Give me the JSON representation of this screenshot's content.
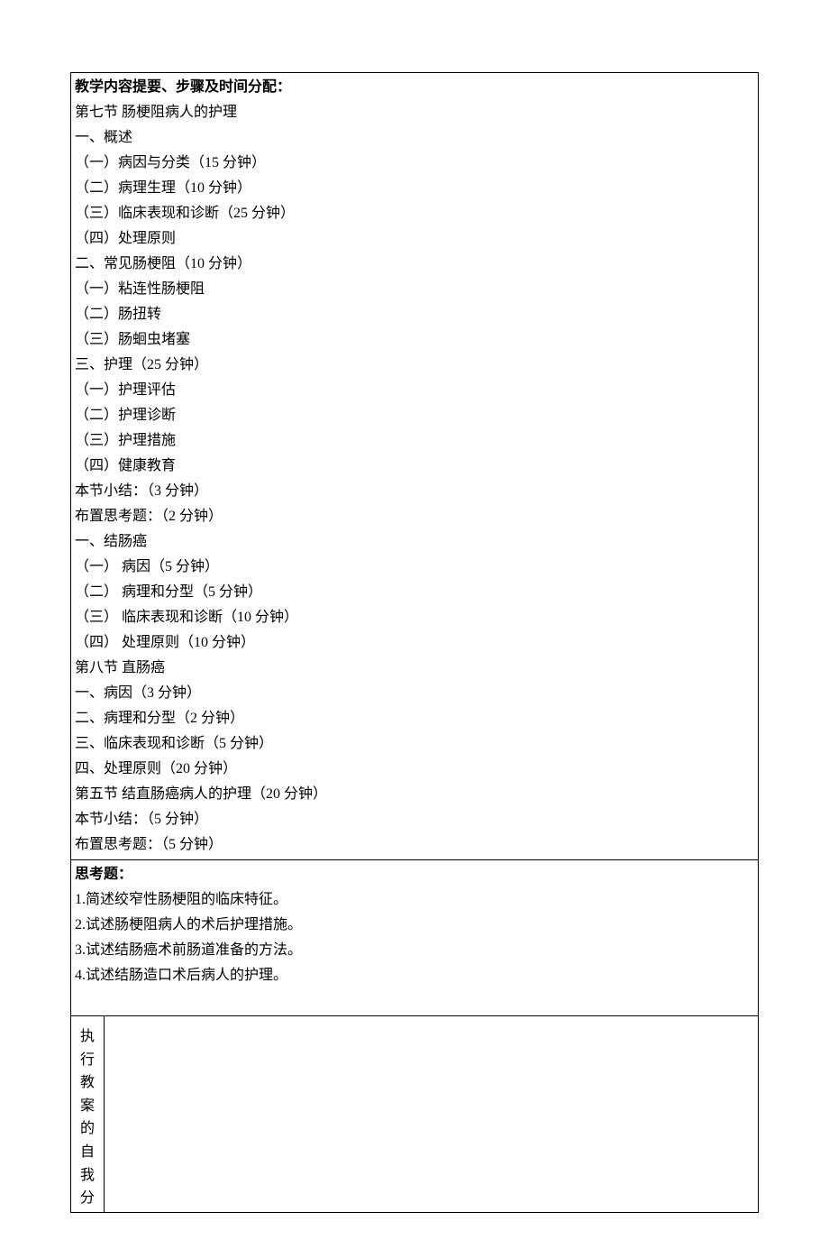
{
  "section1": {
    "header": "教学内容提要、步骤及时间分配：",
    "lines": [
      "第七节 肠梗阻病人的护理",
      "一、概述",
      "（一）病因与分类（15 分钟）",
      "（二）病理生理（10 分钟）",
      "（三）临床表现和诊断（25 分钟）",
      "（四）处理原则",
      "二、常见肠梗阻（10 分钟）",
      "（一）粘连性肠梗阻",
      "（二）肠扭转",
      "（三）肠蛔虫堵塞",
      "三、护理（25 分钟）",
      "（一）护理评估",
      "（二）护理诊断",
      "（三）护理措施",
      "（四）健康教育",
      "本节小结：（3 分钟）",
      "布置思考题：（2 分钟）",
      "一、结肠癌",
      "（一） 病因（5 分钟）",
      "（二） 病理和分型（5 分钟）",
      "（三） 临床表现和诊断（10 分钟）",
      "（四） 处理原则（10 分钟）",
      "第八节   直肠癌",
      "一、病因（3 分钟）",
      "二、病理和分型（2 分钟）",
      "三、临床表现和诊断（5  分钟）",
      "四、处理原则（20 分钟）",
      "第五节   结直肠癌病人的护理（20 分钟）",
      "本节小结：（5 分钟）",
      "布置思考题：（5 分钟）"
    ]
  },
  "section2": {
    "header": "思考题：",
    "lines": [
      "1.简述绞窄性肠梗阻的临床特征。",
      "2.试述肠梗阻病人的术后护理措施。",
      "3.试述结肠癌术前肠道准备的方法。",
      "4.试述结肠造口术后病人的护理。"
    ]
  },
  "section3": {
    "vertical_label": "执行教案的自我分",
    "content": ""
  }
}
